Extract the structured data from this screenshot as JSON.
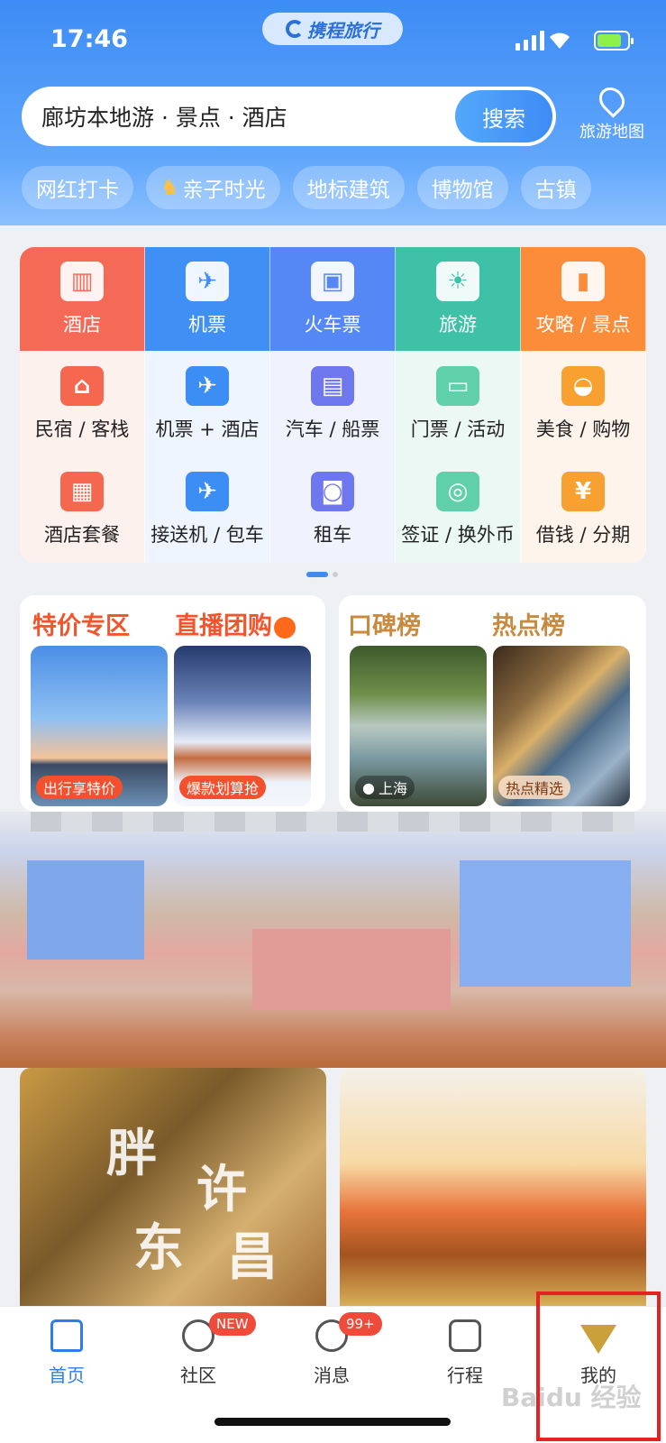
{
  "status_bar": {
    "time": "17:46",
    "app_logo_text": "携程旅行"
  },
  "search": {
    "query": "廊坊本地游 · 景点 · 酒店",
    "button": "搜索"
  },
  "map_button": {
    "label": "旅游地图",
    "icon": "map-pin-icon"
  },
  "tags": [
    "网红打卡",
    "亲子时光",
    "地标建筑",
    "博物馆",
    "古镇"
  ],
  "grid": {
    "top_row": [
      {
        "label": "酒店",
        "icon": "hotel-icon"
      },
      {
        "label": "机票",
        "icon": "plane-icon"
      },
      {
        "label": "火车票",
        "icon": "train-icon"
      },
      {
        "label": "旅游",
        "icon": "palm-tree-icon"
      },
      {
        "label": "攻略 / 景点",
        "icon": "guide-book-icon"
      }
    ],
    "row2": [
      {
        "label": "民宿 / 客栈",
        "icon": "house-icon"
      },
      {
        "label": "机票 + 酒店",
        "icon": "plane-hotel-icon"
      },
      {
        "label": "汽车 / 船票",
        "icon": "bus-icon"
      },
      {
        "label": "门票 / 活动",
        "icon": "ticket-icon"
      },
      {
        "label": "美食 / 购物",
        "icon": "shopping-bag-icon"
      }
    ],
    "row3": [
      {
        "label": "酒店套餐",
        "icon": "hotel-package-icon"
      },
      {
        "label": "接送机 / 包车",
        "icon": "car-plane-icon"
      },
      {
        "label": "租车",
        "icon": "car-icon"
      },
      {
        "label": "签证 / 换外币",
        "icon": "visa-icon"
      },
      {
        "label": "借钱 / 分期",
        "icon": "money-bag-icon"
      }
    ]
  },
  "cards": {
    "left": {
      "title1": "特价专区",
      "title2": "直播团购",
      "badge1": "出行享特价",
      "badge2": "爆款划算抢"
    },
    "right": {
      "title1": "口碑榜",
      "title2": "热点榜",
      "badge1": "上海",
      "badge2": "热点精选"
    }
  },
  "feed": {
    "left_overlay1": "胖",
    "left_overlay2": "东",
    "left_overlay3": "许",
    "left_overlay4": "昌"
  },
  "tabbar": [
    {
      "label": "首页",
      "icon": "home-icon"
    },
    {
      "label": "社区",
      "icon": "community-icon",
      "badge": "NEW"
    },
    {
      "label": "消息",
      "icon": "message-icon",
      "badge": "99+"
    },
    {
      "label": "行程",
      "icon": "calendar-icon"
    },
    {
      "label": "我的",
      "icon": "diamond-icon"
    }
  ],
  "watermark": "Baidu 经验",
  "colors": {
    "primary": "#3d8cf5",
    "highlight_border": "#e52222"
  }
}
